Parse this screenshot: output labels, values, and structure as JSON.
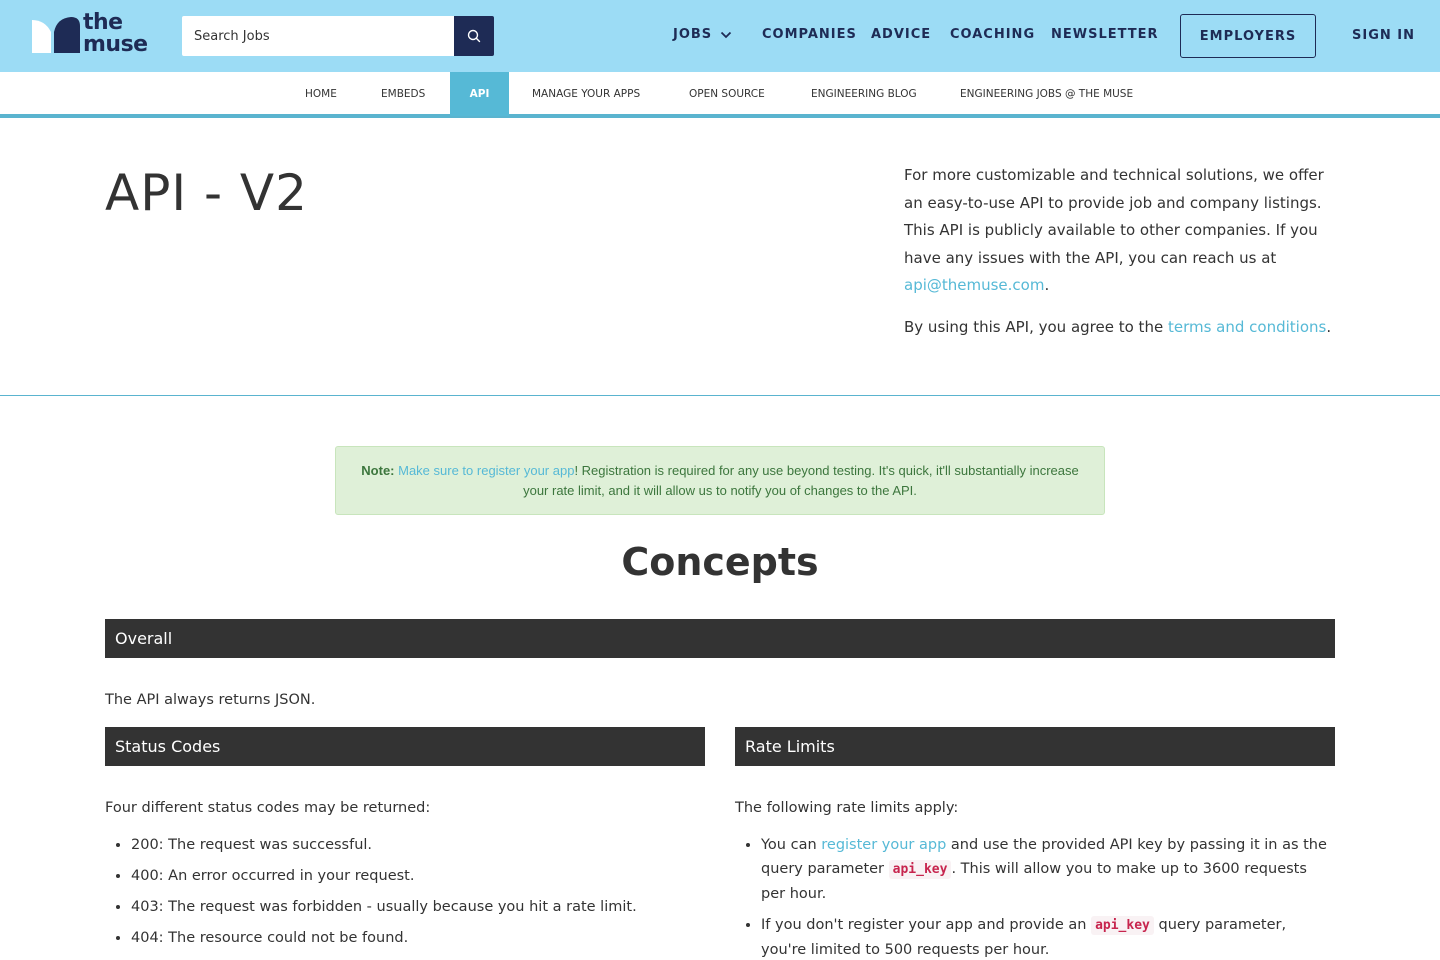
{
  "header": {
    "logo": {
      "line1": "the",
      "line2": "muse"
    },
    "search": {
      "placeholder": "Search Jobs"
    },
    "nav": {
      "jobs": "JOBS",
      "companies": "COMPANIES",
      "advice": "ADVICE",
      "coaching": "COACHING",
      "newsletter": "NEWSLETTER",
      "employers": "EMPLOYERS",
      "signin": "SIGN IN"
    },
    "colors": {
      "bar": "#9cdcf5",
      "brand": "#1e2b55"
    }
  },
  "subnav": {
    "items": [
      "HOME",
      "EMBEDS",
      "API",
      "MANAGE YOUR APPS",
      "OPEN SOURCE",
      "ENGINEERING BLOG",
      "ENGINEERING JOBS @ THE MUSE"
    ],
    "active": "API"
  },
  "hero": {
    "title": "API - V2",
    "desc1": "For more customizable and technical solutions, we offer an easy-to-use API to provide job and company listings. This API is publicly available to other companies. If you have any issues with the API, you can reach us at ",
    "email": "api@themuse.com",
    "desc1_end": ".",
    "desc2": "By using this API, you agree to the ",
    "terms": "terms and conditions",
    "desc2_end": "."
  },
  "note": {
    "label": "Note:",
    "link": "Make sure to register your app",
    "text": "! Registration is required for any use beyond testing. It's quick, it'll substantially increase your rate limit, and it will allow us to notify you of changes to the API."
  },
  "concepts": {
    "title": "Concepts",
    "overall": {
      "heading": "Overall",
      "text": "The API always returns JSON."
    },
    "status": {
      "heading": "Status Codes",
      "intro": "Four different status codes may be returned:",
      "items": [
        "200: The request was successful.",
        "400: An error occurred in your request.",
        "403: The request was forbidden - usually because you hit a rate limit.",
        "404: The resource could not be found."
      ]
    },
    "rate": {
      "heading": "Rate Limits",
      "intro": "The following rate limits apply:",
      "item1_a": "You can ",
      "item1_link": "register your app",
      "item1_b": " and use the provided API key by passing it in as the query parameter ",
      "item1_code": "api_key",
      "item1_c": ". This will allow you to make up to 3600 requests per hour.",
      "item2_a": "If you don't register your app and provide an ",
      "item2_code": "api_key",
      "item2_b": " query parameter, you're limited to 500 requests per hour."
    }
  }
}
